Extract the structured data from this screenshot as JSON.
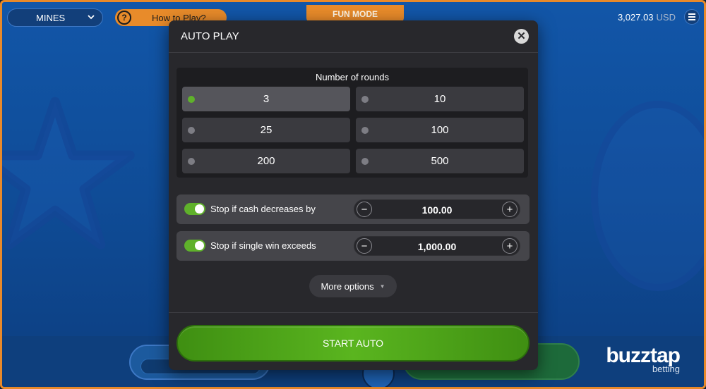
{
  "topbar": {
    "game_select_label": "MINES",
    "how_to_play_label": "How to Play?",
    "help_symbol": "?",
    "mode_badge": "FUN MODE",
    "balance_amount": "3,027.03",
    "balance_currency": "USD"
  },
  "modal": {
    "title": "AUTO PLAY",
    "close_symbol": "✕",
    "rounds_title": "Number of rounds",
    "rounds": [
      {
        "label": "3",
        "selected": true
      },
      {
        "label": "10",
        "selected": false
      },
      {
        "label": "25",
        "selected": false
      },
      {
        "label": "100",
        "selected": false
      },
      {
        "label": "200",
        "selected": false
      },
      {
        "label": "500",
        "selected": false
      }
    ],
    "stop_cash_decrease": {
      "label": "Stop if cash decreases by",
      "value": "100.00",
      "enabled": true
    },
    "stop_single_win": {
      "label": "Stop if single win exceeds",
      "value": "1,000.00",
      "enabled": true
    },
    "stepper_minus": "−",
    "stepper_plus": "+",
    "more_options_label": "More options",
    "start_button_label": "START AUTO"
  },
  "branding": {
    "name": "buzztap",
    "tagline": "betting"
  },
  "colors": {
    "accent_orange": "#e88b2a",
    "toggle_on": "#5fb12b",
    "start_green": "#5ab51f",
    "modal_bg": "#28282c"
  }
}
